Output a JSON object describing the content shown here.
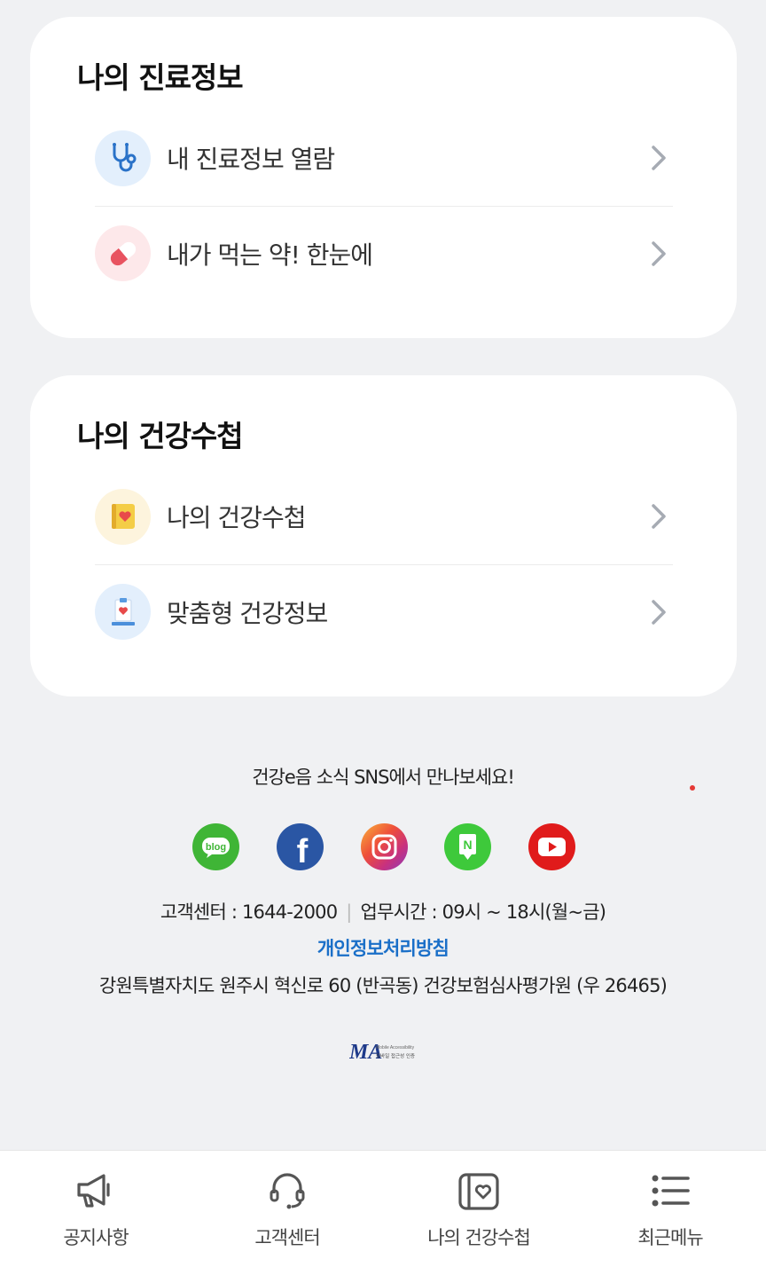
{
  "sections": [
    {
      "title": "나의 진료정보",
      "items": [
        {
          "label": "내 진료정보 열람",
          "icon": "stethoscope-icon"
        },
        {
          "label": "내가 먹는 약! 한눈에",
          "icon": "pill-icon"
        }
      ]
    },
    {
      "title": "나의 건강수첩",
      "items": [
        {
          "label": "나의 건강수첩",
          "icon": "health-notebook-icon"
        },
        {
          "label": "맞춤형 건강정보",
          "icon": "health-info-icon"
        }
      ]
    }
  ],
  "footer": {
    "sns_title": "건강e음 소식 SNS에서 만나보세요!",
    "sns": [
      {
        "name": "blog",
        "label": "blog"
      },
      {
        "name": "facebook",
        "label": "f"
      },
      {
        "name": "instagram",
        "label": ""
      },
      {
        "name": "naver-post",
        "label": "N"
      },
      {
        "name": "youtube",
        "label": ""
      }
    ],
    "customer_center": "고객센터 : 1644-2000",
    "separator": "|",
    "business_hours": "업무시간 : 09시 ~ 18시(월~금)",
    "privacy_policy": "개인정보처리방침",
    "address": "강원특별자치도 원주시 혁신로 60 (반곡동) 건강보험심사평가원 (우 26465)",
    "ma_logo_text": "MA",
    "ma_caption_1": "Mobile Accessibility",
    "ma_caption_2": "모바일 접근성 인증"
  },
  "tabbar": [
    {
      "label": "공지사항",
      "icon": "megaphone-icon"
    },
    {
      "label": "고객센터",
      "icon": "headset-icon"
    },
    {
      "label": "나의 건강수첩",
      "icon": "notebook-icon"
    },
    {
      "label": "최근메뉴",
      "icon": "list-menu-icon"
    }
  ],
  "colors": {
    "background": "#f0f1f3",
    "card": "#ffffff",
    "link_blue": "#1a6fc8",
    "chevron": "#a6abb3"
  }
}
